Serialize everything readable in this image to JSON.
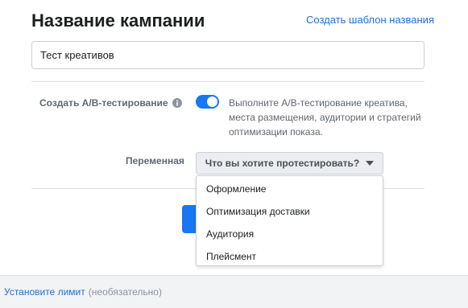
{
  "campaign": {
    "title": "Название кампании",
    "template_link": "Создать шаблон названия",
    "name_value": "Тест креативов"
  },
  "ab_test": {
    "label": "Создать A/B-тестирование",
    "info_icon": "info-icon",
    "toggle_on": true,
    "description": "Выполните A/B-тестирование креатива, места размещения, аудитории и стратегий оптимизации показа."
  },
  "variable": {
    "label": "Переменная",
    "dropdown_placeholder": "Что вы хотите протестировать?",
    "options": [
      "Оформление",
      "Оптимизация доставки",
      "Аудитория",
      "Плейсмент"
    ]
  },
  "footer": {
    "limit_link": "Установите лимит",
    "optional_note": "(необязательно)"
  },
  "colors": {
    "accent": "#1877f2",
    "link": "#216fdb"
  }
}
